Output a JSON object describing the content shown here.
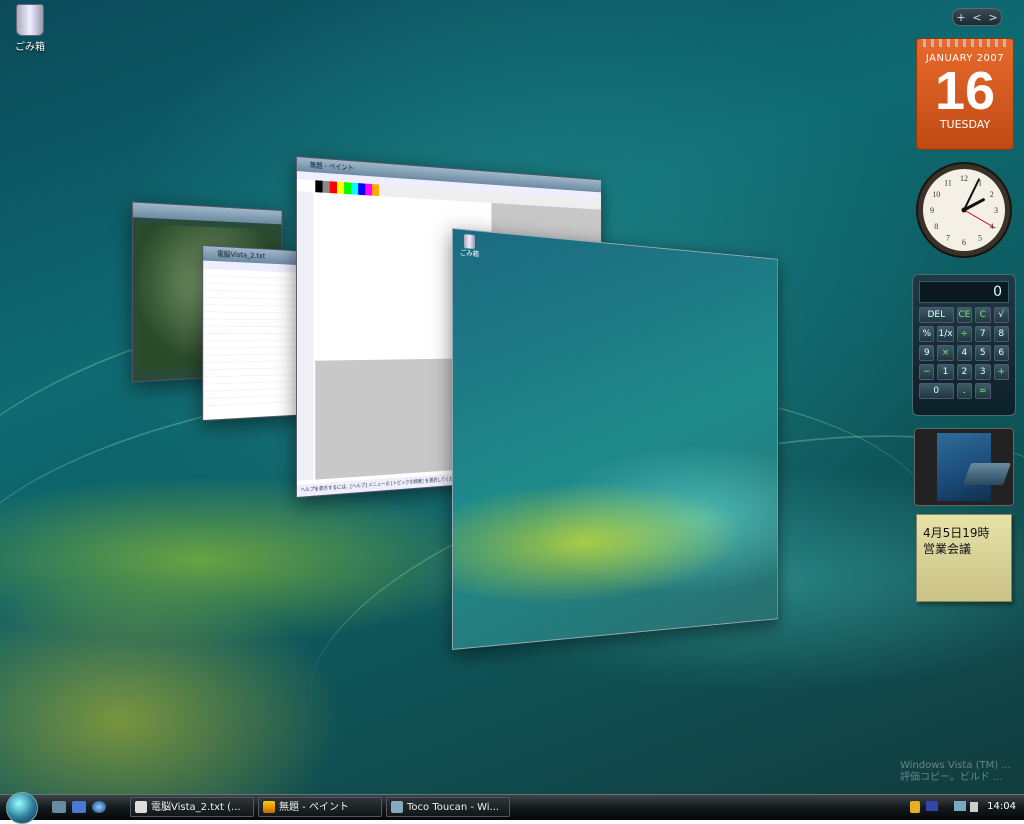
{
  "desktop": {
    "icons": [
      {
        "label": "ごみ箱"
      }
    ]
  },
  "flip3d": {
    "paint": {
      "title": "無題 - ペイント",
      "status": "ヘルプを表示するには、[ヘルプ] メニューの [トピックの検索] を選択してください。"
    },
    "notepad": {
      "title": "電脳Vista_2.txt"
    },
    "desktop_preview": {
      "icon_label": "ごみ箱"
    }
  },
  "sidebar": {
    "controls": [
      "+",
      "<",
      ">"
    ],
    "calendar": {
      "month": "JANUARY 2007",
      "day": "16",
      "weekday": "TUESDAY"
    },
    "clock": {
      "hour": 2,
      "minute": 4,
      "second": 20
    },
    "calculator": {
      "display": "0",
      "keys": [
        "DEL",
        "CE",
        "C",
        "√",
        "%",
        "1/x",
        "÷",
        "7",
        "8",
        "9",
        "×",
        "4",
        "5",
        "6",
        "−",
        "1",
        "2",
        "3",
        "+",
        "0",
        ".",
        "="
      ]
    },
    "note": {
      "line1": "4月5日19時",
      "line2": "営業会議"
    }
  },
  "watermark": {
    "line1": "Windows Vista (TM) ...",
    "line2": "評価コピー。ビルド ..."
  },
  "taskbar": {
    "tasks": [
      {
        "label": "電脳Vista_2.txt (..."
      },
      {
        "label": "無題 - ペイント"
      },
      {
        "label": "Toco Toucan - Wi..."
      }
    ],
    "clock": "14:04"
  },
  "colors": {
    "accent": "#e86a2c",
    "taskbar": "#141a1c"
  }
}
